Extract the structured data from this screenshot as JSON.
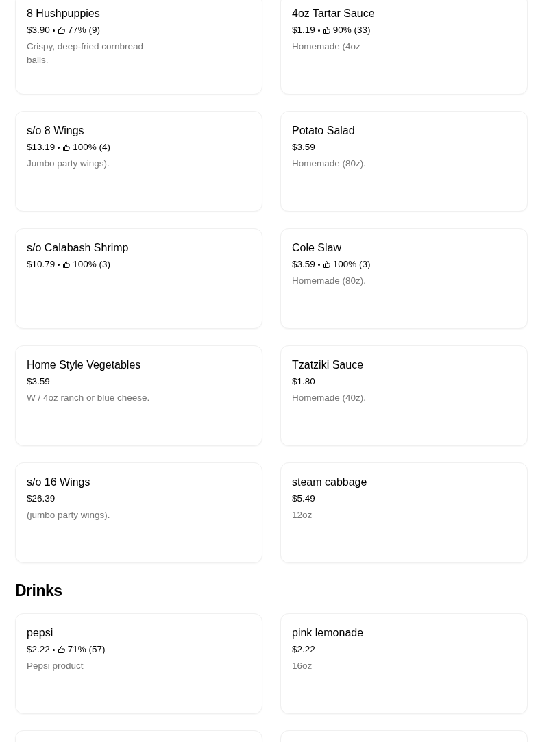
{
  "sections": [
    {
      "items": [
        {
          "name": "8 Hushpuppies",
          "price": "$3.90",
          "rating": "77% (9)",
          "description": "Crispy, deep-fried cornbread balls."
        },
        {
          "name": "4oz Tartar Sauce",
          "price": "$1.19",
          "rating": "90% (33)",
          "description": "Homemade (4oz"
        },
        {
          "name": "s/o 8 Wings",
          "price": "$13.19",
          "rating": "100% (4)",
          "description": "Jumbo party wings)."
        },
        {
          "name": "Potato Salad",
          "price": "$3.59",
          "description": "Homemade (80z)."
        },
        {
          "name": "s/o Calabash Shrimp",
          "price": "$10.79",
          "rating": "100% (3)"
        },
        {
          "name": "Cole Slaw",
          "price": "$3.59",
          "rating": "100% (3)",
          "description": "Homemade (80z)."
        },
        {
          "name": "Home Style Vegetables",
          "price": "$3.59",
          "description": "W / 4oz ranch or blue cheese."
        },
        {
          "name": "Tzatziki Sauce",
          "price": "$1.80",
          "description": "Homemade (40z)."
        },
        {
          "name": "s/o 16 Wings",
          "price": "$26.39",
          "description": "(jumbo party wings)."
        },
        {
          "name": "steam cabbage",
          "price": "$5.49",
          "description": "12oz"
        }
      ]
    },
    {
      "title": "Drinks",
      "items": [
        {
          "name": "pepsi",
          "price": "$2.22",
          "rating": "71% (57)",
          "description": "Pepsi product"
        },
        {
          "name": "pink lemonade",
          "price": "$2.22",
          "description": "16oz"
        }
      ]
    }
  ]
}
